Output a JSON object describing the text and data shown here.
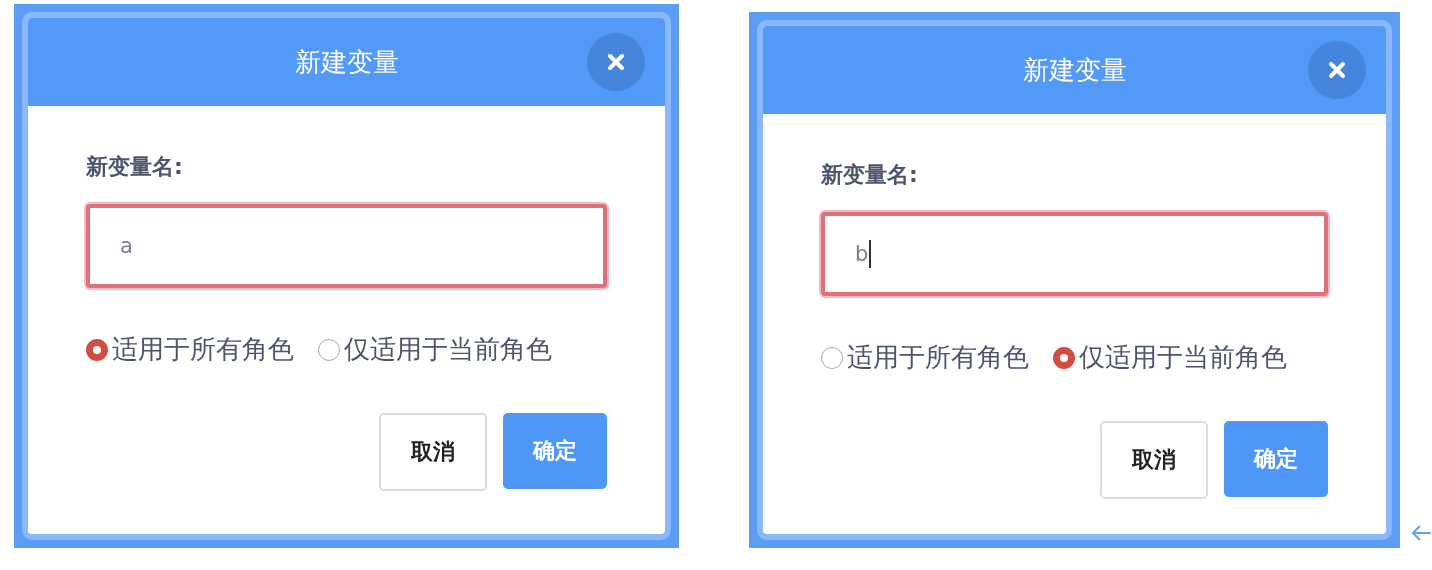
{
  "dialogs": [
    {
      "title": "新建变量",
      "field_label": "新变量名:",
      "field_value": "a",
      "cursor": false,
      "scope_options": [
        {
          "label": "适用于所有角色",
          "selected": true
        },
        {
          "label": "仅适用于当前角色",
          "selected": false
        }
      ],
      "buttons": [
        {
          "label": "取消",
          "kind": "secondary"
        },
        {
          "label": "确定",
          "kind": "primary"
        }
      ]
    },
    {
      "title": "新建变量",
      "field_label": "新变量名:",
      "field_value": "b",
      "cursor": true,
      "scope_options": [
        {
          "label": "适用于所有角色",
          "selected": false
        },
        {
          "label": "仅适用于当前角色",
          "selected": true
        }
      ],
      "buttons": [
        {
          "label": "取消",
          "kind": "secondary"
        },
        {
          "label": "确定",
          "kind": "primary"
        }
      ]
    }
  ]
}
